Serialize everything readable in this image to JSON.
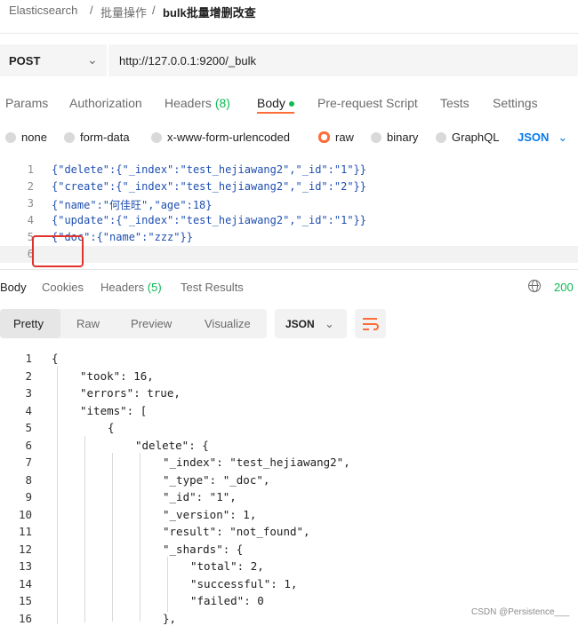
{
  "breadcrumb": {
    "root": "Elasticsearch",
    "sep": "/",
    "folder": "批量操作",
    "current": "bulk批量增删改查"
  },
  "request": {
    "method": "POST",
    "url": "http://127.0.0.1:9200/_bulk"
  },
  "request_tabs": {
    "params": "Params",
    "authorization": "Authorization",
    "headers": "Headers",
    "headers_count": "(8)",
    "body": "Body",
    "prerequest": "Pre-request Script",
    "tests": "Tests",
    "settings": "Settings"
  },
  "body_types": {
    "none": "none",
    "form_data": "form-data",
    "urlencoded": "x-www-form-urlencoded",
    "raw": "raw",
    "binary": "binary",
    "graphql": "GraphQL",
    "selected_format": "JSON"
  },
  "request_body": {
    "line_numbers": [
      "1",
      "2",
      "3",
      "4",
      "5",
      "6"
    ],
    "lines": [
      "{\"delete\":{\"_index\":\"test_hejiawang2\",\"_id\":\"1\"}}",
      "{\"create\":{\"_index\":\"test_hejiawang2\",\"_id\":\"2\"}}",
      "{\"name\":\"何佳旺\",\"age\":18}",
      "{\"update\":{\"_index\":\"test_hejiawang2\",\"_id\":\"1\"}}",
      "{\"doc\":{\"name\":\"zzz\"}}",
      ""
    ]
  },
  "response_tabs": {
    "body": "Body",
    "cookies": "Cookies",
    "headers": "Headers",
    "headers_count": "(5)",
    "test_results": "Test Results",
    "status": "200"
  },
  "view_modes": {
    "pretty": "Pretty",
    "raw": "Raw",
    "preview": "Preview",
    "visualize": "Visualize",
    "format": "JSON"
  },
  "response_body": {
    "line_numbers": [
      "1",
      "2",
      "3",
      "4",
      "5",
      "6",
      "7",
      "8",
      "9",
      "10",
      "11",
      "12",
      "13",
      "14",
      "15",
      "16"
    ],
    "lines": [
      "{",
      "\"took\": 16,",
      "\"errors\": true,",
      "\"items\": [",
      "{",
      "\"delete\": {",
      "\"_index\": \"test_hejiawang2\",",
      "\"_type\": \"_doc\",",
      "\"_id\": \"1\",",
      "\"_version\": 1,",
      "\"result\": \"not_found\",",
      "\"_shards\": {",
      "\"total\": 2,",
      "\"successful\": 1,",
      "\"failed\": 0",
      "},"
    ]
  },
  "watermark": "CSDN @Persistence___",
  "colors": {
    "accent": "#ff6c37",
    "link": "#097bed",
    "success": "#0cbb52",
    "highlight_box": "#e0332d"
  }
}
